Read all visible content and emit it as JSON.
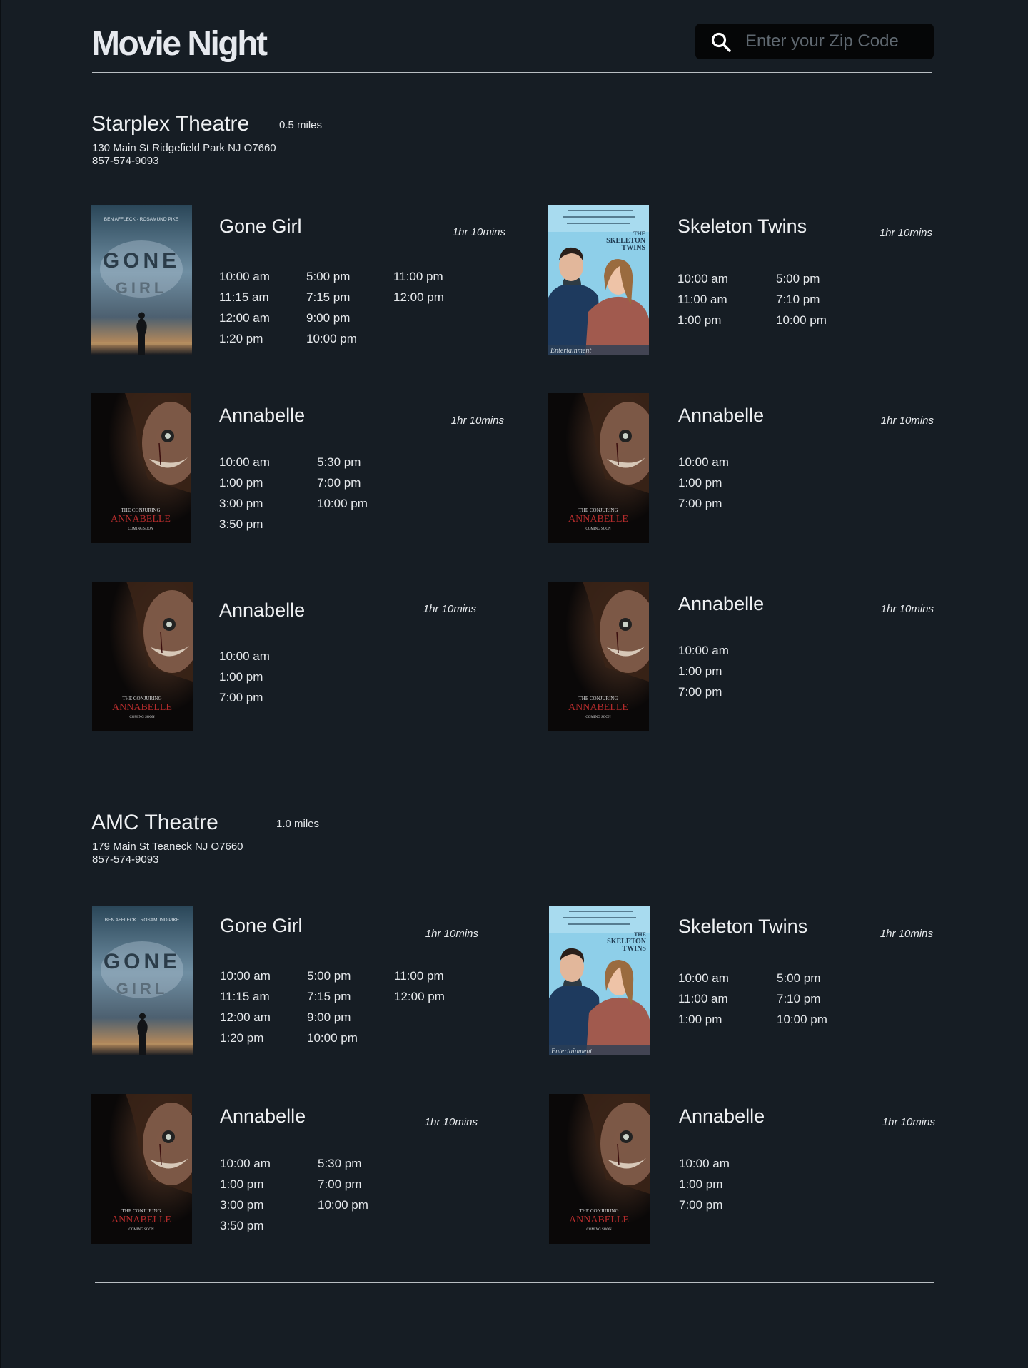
{
  "header": {
    "logo": "Movie Night",
    "search": {
      "placeholder": "Enter your Zip Code",
      "value": ""
    }
  },
  "theatres": [
    {
      "name": "Starplex Theatre",
      "distance": "0.5 miles",
      "address": "130  Main St Ridgefield Park NJ O7660",
      "phone": "857-574-9093",
      "movies": [
        {
          "poster": "gone-girl",
          "poster_text": {
            "top": "BEN AFFLECK · ROSAMUND PIKE",
            "title1": "GONE",
            "title2": "GIRL"
          },
          "title": "Gone Girl",
          "duration": "1hr 10mins",
          "times": [
            [
              "10:00 am",
              "11:15 am",
              "12:00 am",
              "1:20 pm"
            ],
            [
              "5:00 pm",
              "7:15 pm",
              "9:00 pm",
              "10:00 pm"
            ],
            [
              "11:00 pm",
              "12:00 pm"
            ]
          ]
        },
        {
          "poster": "skeleton-twins",
          "poster_text": {
            "title1": "THE",
            "title2": "SKELETON",
            "title3": "TWINS",
            "footer": "Entertainment"
          },
          "title": "Skeleton Twins",
          "duration": "1hr 10mins",
          "times": [
            [
              "10:00 am",
              "11:00 am",
              "1:00 pm"
            ],
            [
              "5:00 pm",
              "7:10 pm",
              "10:00 pm"
            ]
          ]
        },
        {
          "poster": "annabelle",
          "poster_text": {
            "pre": "THE CONJURING",
            "title": "ANNABELLE",
            "footer": "COMING SOON"
          },
          "title": "Annabelle",
          "duration": "1hr 10mins",
          "times": [
            [
              "10:00 am",
              "1:00 pm",
              "3:00 pm",
              "3:50 pm"
            ],
            [
              "5:30 pm",
              "7:00 pm",
              "10:00 pm"
            ]
          ]
        },
        {
          "poster": "annabelle",
          "poster_text": {
            "pre": "THE CONJURING",
            "title": "ANNABELLE",
            "footer": "COMING SOON"
          },
          "title": "Annabelle",
          "duration": "1hr 10mins",
          "times": [
            [
              "10:00 am",
              "1:00 pm",
              "7:00 pm"
            ]
          ]
        },
        {
          "poster": "annabelle",
          "poster_text": {
            "pre": "THE CONJURING",
            "title": "ANNABELLE",
            "footer": "COMING SOON"
          },
          "title": "Annabelle",
          "duration": "1hr 10mins",
          "times": [
            [
              "10:00 am",
              "1:00 pm",
              "7:00 pm"
            ]
          ]
        },
        {
          "poster": "annabelle",
          "poster_text": {
            "pre": "THE CONJURING",
            "title": "ANNABELLE",
            "footer": "COMING SOON"
          },
          "title": "Annabelle",
          "duration": "1hr 10mins",
          "times": [
            [
              "10:00 am",
              "1:00 pm",
              "7:00 pm"
            ]
          ]
        }
      ]
    },
    {
      "name": "AMC Theatre",
      "distance": "1.0 miles",
      "address": "179  Main St Teaneck NJ O7660",
      "phone": "857-574-9093",
      "movies": [
        {
          "poster": "gone-girl",
          "poster_text": {
            "top": "BEN AFFLECK · ROSAMUND PIKE",
            "title1": "GONE",
            "title2": "GIRL"
          },
          "title": "Gone Girl",
          "duration": "1hr 10mins",
          "times": [
            [
              "10:00 am",
              "11:15 am",
              "12:00 am",
              "1:20 pm"
            ],
            [
              "5:00 pm",
              "7:15 pm",
              "9:00 pm",
              "10:00 pm"
            ],
            [
              "11:00 pm",
              "12:00 pm"
            ]
          ]
        },
        {
          "poster": "skeleton-twins",
          "poster_text": {
            "title1": "THE",
            "title2": "SKELETON",
            "title3": "TWINS",
            "footer": "Entertainment"
          },
          "title": "Skeleton Twins",
          "duration": "1hr 10mins",
          "times": [
            [
              "10:00 am",
              "11:00 am",
              "1:00 pm"
            ],
            [
              "5:00 pm",
              "7:10 pm",
              "10:00 pm"
            ]
          ]
        },
        {
          "poster": "annabelle",
          "poster_text": {
            "pre": "THE CONJURING",
            "title": "ANNABELLE",
            "footer": "COMING SOON"
          },
          "title": "Annabelle",
          "duration": "1hr 10mins",
          "times": [
            [
              "10:00 am",
              "1:00 pm",
              "3:00 pm",
              "3:50 pm"
            ],
            [
              "5:30 pm",
              "7:00 pm",
              "10:00 pm"
            ]
          ]
        },
        {
          "poster": "annabelle",
          "poster_text": {
            "pre": "THE CONJURING",
            "title": "ANNABELLE",
            "footer": "COMING SOON"
          },
          "title": "Annabelle",
          "duration": "1hr 10mins",
          "times": [
            [
              "10:00 am",
              "1:00 pm",
              "7:00 pm"
            ]
          ]
        }
      ]
    }
  ]
}
